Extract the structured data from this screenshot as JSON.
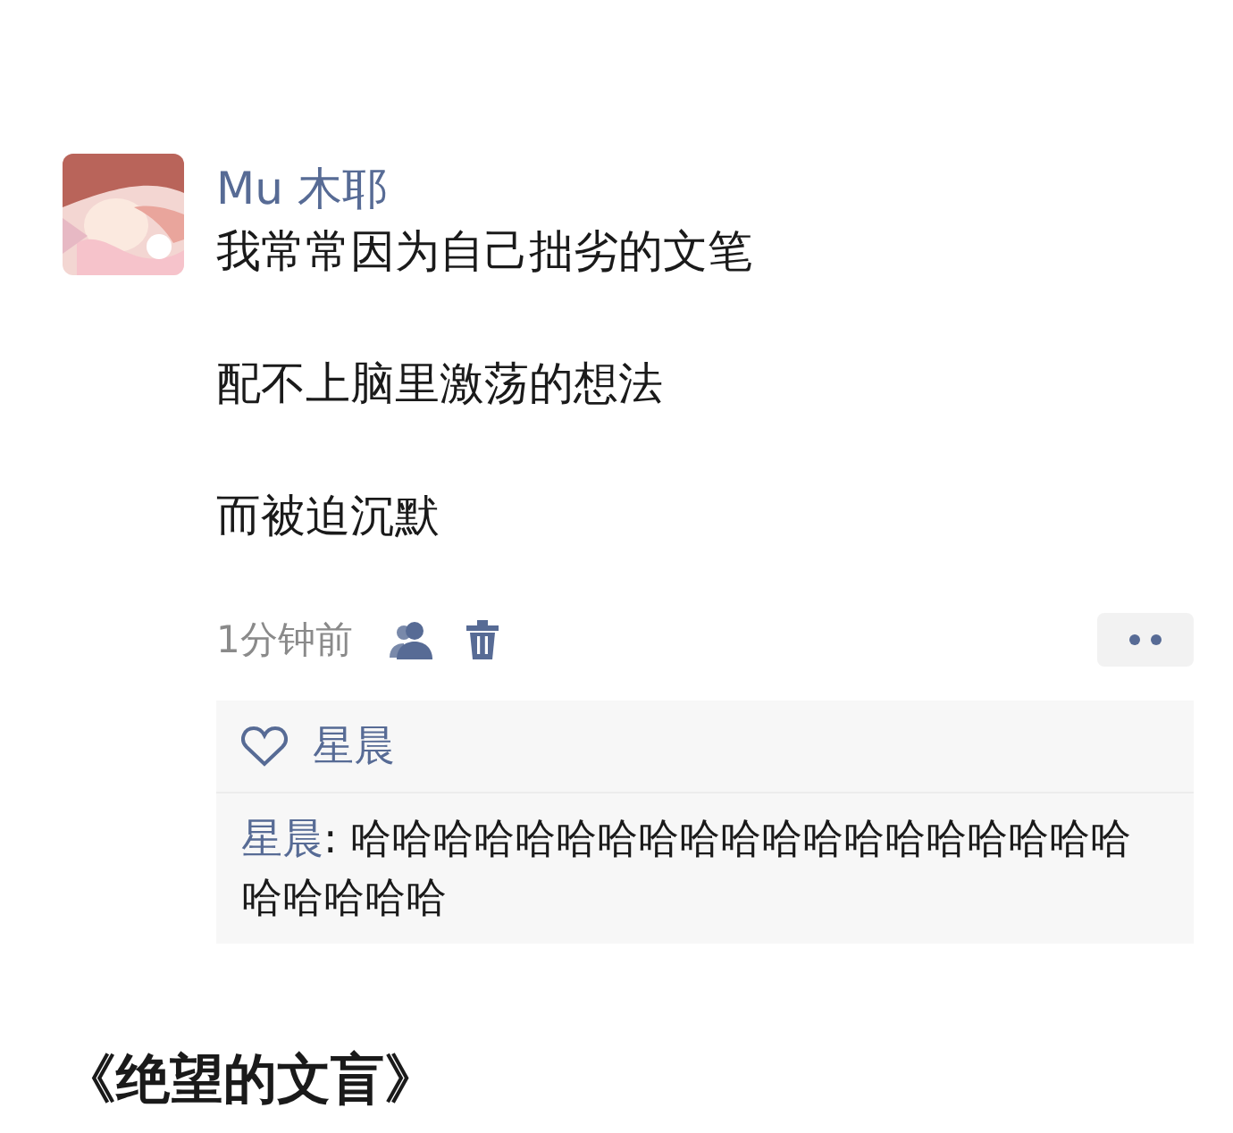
{
  "post": {
    "author": "Mu 木耶",
    "paragraphs": [
      "我常常因为自己拙劣的文笔",
      "配不上脑里激荡的想法",
      "而被迫沉默"
    ],
    "time": "1分钟前",
    "likes": [
      "星晨"
    ],
    "comments": [
      {
        "author": "星晨",
        "separator": ":",
        "text": "哈哈哈哈哈哈哈哈哈哈哈哈哈哈哈哈哈哈哈哈哈哈哈哈"
      }
    ]
  },
  "next_title": "《绝望的文盲》"
}
